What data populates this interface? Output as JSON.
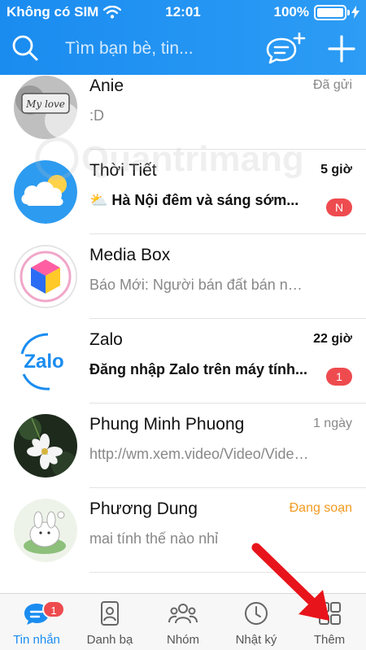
{
  "status_bar": {
    "carrier": "Không có SIM",
    "time": "12:01",
    "battery": "100%"
  },
  "search": {
    "placeholder": "Tìm bạn bè, tin..."
  },
  "watermark": "Quantrimang",
  "conversations": [
    {
      "name": "Anie",
      "preview": ":D",
      "time": "Đã gửi",
      "unread": false,
      "badge": "",
      "avatar": "my-love-photo"
    },
    {
      "name": "Thời Tiết",
      "preview": "⛅ Hà Nội đêm và sáng sớm...",
      "time": "5 giờ",
      "unread": true,
      "badge": "N",
      "avatar": "weather-cloud-icon"
    },
    {
      "name": "Media Box",
      "preview": "Báo Mới: Người bán đất bán nhà...",
      "time": "",
      "unread": false,
      "badge": "",
      "avatar": "media-box-cube-icon"
    },
    {
      "name": "Zalo",
      "preview": "Đăng nhập Zalo trên máy tính...",
      "time": "22 giờ",
      "unread": true,
      "badge": "1",
      "avatar": "zalo-logo"
    },
    {
      "name": "Phung Minh Phuong",
      "preview": "http://wm.xem.video/Video/Videos",
      "time": "1 ngày",
      "unread": false,
      "badge": "",
      "avatar": "flower-photo"
    },
    {
      "name": "Phương Dung",
      "preview": "mai tính thế nào nhỉ",
      "time": "Đang soạn",
      "unread": false,
      "badge": "",
      "avatar": "bunny-sticker"
    }
  ],
  "tabs": [
    {
      "label": "Tin nhắn",
      "icon": "chat-bubble-icon",
      "active": true,
      "badge": "1"
    },
    {
      "label": "Danh bạ",
      "icon": "contacts-icon",
      "active": false,
      "badge": ""
    },
    {
      "label": "Nhóm",
      "icon": "group-icon",
      "active": false,
      "badge": ""
    },
    {
      "label": "Nhật ký",
      "icon": "clock-icon",
      "active": false,
      "badge": ""
    },
    {
      "label": "Thêm",
      "icon": "grid-icon",
      "active": false,
      "badge": ""
    }
  ],
  "colors": {
    "header": "#1a8cf0",
    "badge": "#ee4b4f",
    "active_tab": "#1a8cf0",
    "typing": "#f29a1f",
    "annotation_arrow": "#e8141b"
  }
}
